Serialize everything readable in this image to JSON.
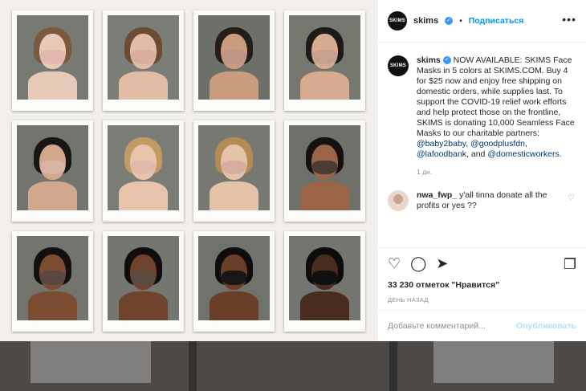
{
  "background": {
    "color": "#5c5c5c"
  },
  "post": {
    "photos": [
      {
        "skin": "#e6c9b6",
        "hair": "#7a5a3e",
        "mask": "#e2b8ad",
        "bg": "#777a73"
      },
      {
        "skin": "#e3bca5",
        "hair": "#6b4b33",
        "mask": "#d9aea0",
        "bg": "#7b7d77"
      },
      {
        "skin": "#c99c7f",
        "hair": "#241d18",
        "mask": "#bf9584",
        "bg": "#6d7069"
      },
      {
        "skin": "#d6ab8f",
        "hair": "#1d1a17",
        "mask": "#c8a08e",
        "bg": "#767870"
      },
      {
        "skin": "#d2a88d",
        "hair": "#1a1613",
        "mask": "#d9b3a3",
        "bg": "#72746e"
      },
      {
        "skin": "#e7c4ab",
        "hair": "#c29a63",
        "mask": "#e0b9aa",
        "bg": "#7a7c76"
      },
      {
        "skin": "#e5c3a8",
        "hair": "#b58b55",
        "mask": "#d7ad9d",
        "bg": "#767871"
      },
      {
        "skin": "#9a6446",
        "hair": "#141110",
        "mask": "#4a3c34",
        "bg": "#6e7069"
      },
      {
        "skin": "#7d4d33",
        "hair": "#121010",
        "mask": "#5a4840",
        "bg": "#72746d"
      },
      {
        "skin": "#6f432c",
        "hair": "#100d0c",
        "mask": "#5b4a40",
        "bg": "#747670"
      },
      {
        "skin": "#6a3f28",
        "hair": "#0f0d0c",
        "mask": "#181616",
        "bg": "#70726c"
      },
      {
        "skin": "#4a2c1d",
        "hair": "#0e0c0b",
        "mask": "#101010",
        "bg": "#737570"
      }
    ]
  },
  "header": {
    "avatar_text": "SKIMS",
    "username": "skims",
    "verified_icon": "✓",
    "separator": "•",
    "follow_label": "Подписаться",
    "more_icon": "•••"
  },
  "caption": {
    "avatar_text": "SKIMS",
    "username": "skims",
    "text": "NOW AVAILABLE: SKIMS Face Masks in 5 colors at SKIMS.COM. Buy 4 for $25 now and enjoy free shipping on domestic orders, while supplies last. To support the COVID-19 relief work efforts and help protect those on the frontline, SKIMS is donating 10,000 Seamless Face Masks to our charitable partners: ",
    "mention1": "@baby2baby",
    "sep1": ", ",
    "mention2": "@goodplusfdn",
    "sep2": ", ",
    "mention3": "@lafoodbank",
    "sep3": ", and ",
    "mention4": "@domesticworkers",
    "end": ".",
    "age": "1 дн."
  },
  "comment": {
    "username": "nwa_fwp_",
    "text": "y'all tinna donate all the profits or yes ??",
    "heart_icon": "♡"
  },
  "actions": {
    "like_icon": "♡",
    "comment_icon": "◯",
    "share_icon": "➤",
    "save_icon": "❐",
    "likes": "33 230 отметок \"Нравится\"",
    "when": "День назад"
  },
  "add_comment": {
    "placeholder": "Добавьте комментарий...",
    "post_label": "Опубликовать"
  }
}
